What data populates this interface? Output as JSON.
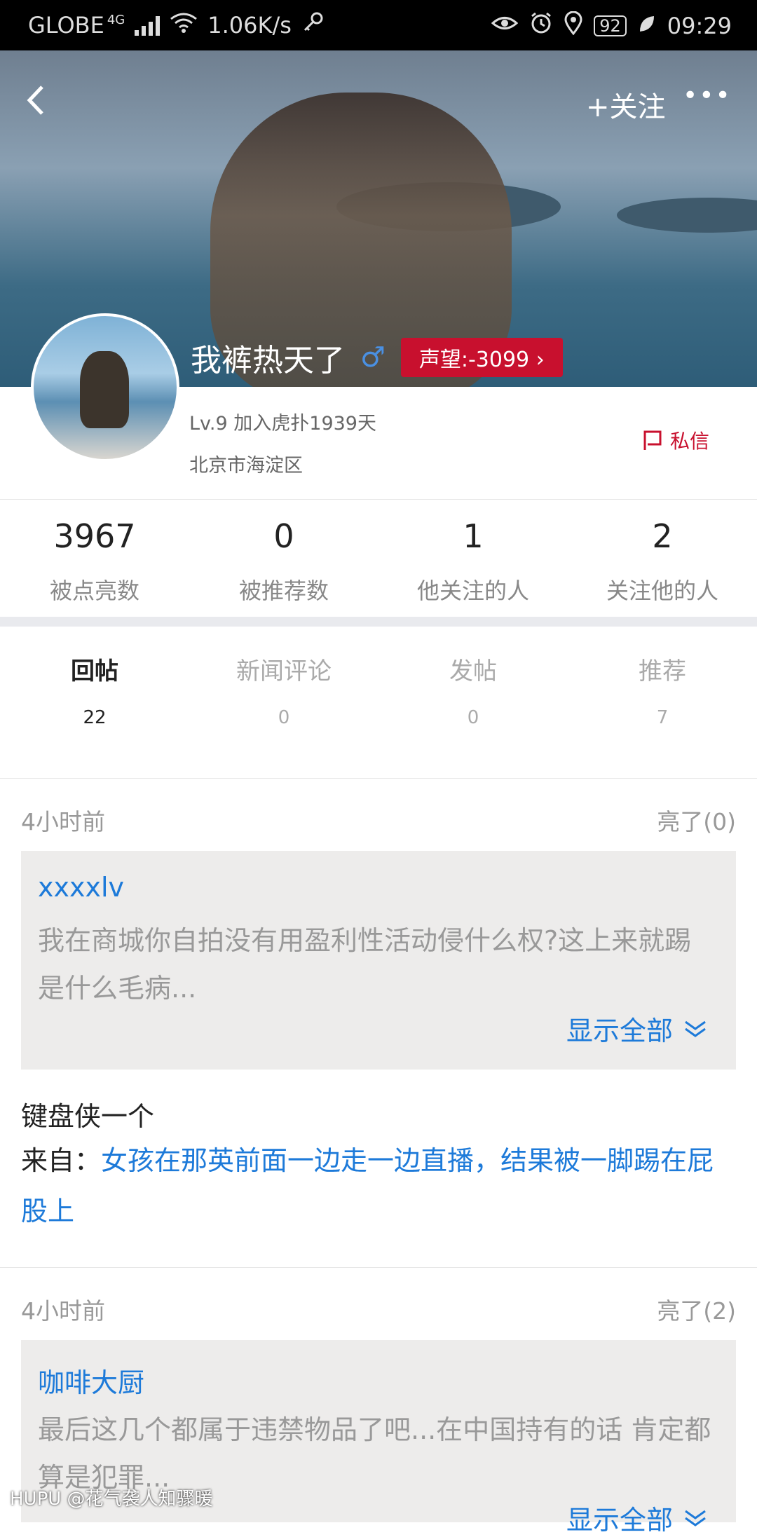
{
  "status_bar": {
    "carrier": "GLOBE",
    "network": "4G",
    "speed": "1.06K/s",
    "battery": "92",
    "time": "09:29"
  },
  "header": {
    "follow_label": "+关注",
    "more_label": "•••",
    "username": "我裤热天了",
    "gender_symbol": "♂",
    "reputation": "声望:-3099",
    "level_join": "Lv.9  加入虎扑1939天",
    "location": "北京市海淀区",
    "message_label": "私信"
  },
  "stats": [
    {
      "num": "3967",
      "label": "被点亮数"
    },
    {
      "num": "0",
      "label": "被推荐数"
    },
    {
      "num": "1",
      "label": "他关注的人"
    },
    {
      "num": "2",
      "label": "关注他的人"
    }
  ],
  "tabs": [
    {
      "label": "回帖",
      "count": "22"
    },
    {
      "label": "新闻评论",
      "count": "0"
    },
    {
      "label": "发帖",
      "count": "0"
    },
    {
      "label": "推荐",
      "count": "7"
    }
  ],
  "posts": [
    {
      "time": "4小时前",
      "liang": "亮了(0)",
      "quote_author": "xxxxlv",
      "quote_text": "我在商城你自拍没有用盈利性活动侵什么权?这上来就踢是什么毛病...",
      "show_all": "显示全部",
      "reply": "键盘侠一个",
      "from_prefix": "来自：",
      "from_title": "女孩在那英前面一边走一边直播，结果被一脚踢在屁股上"
    },
    {
      "time": "4小时前",
      "liang": "亮了(2)",
      "quote_author": "咖啡大厨",
      "quote_text": "最后这几个都属于违禁物品了吧...在中国持有的话 肯定都算是犯罪...",
      "show_all": "显示全部"
    }
  ],
  "watermark": "HUPU @花气袭人知骤暖"
}
